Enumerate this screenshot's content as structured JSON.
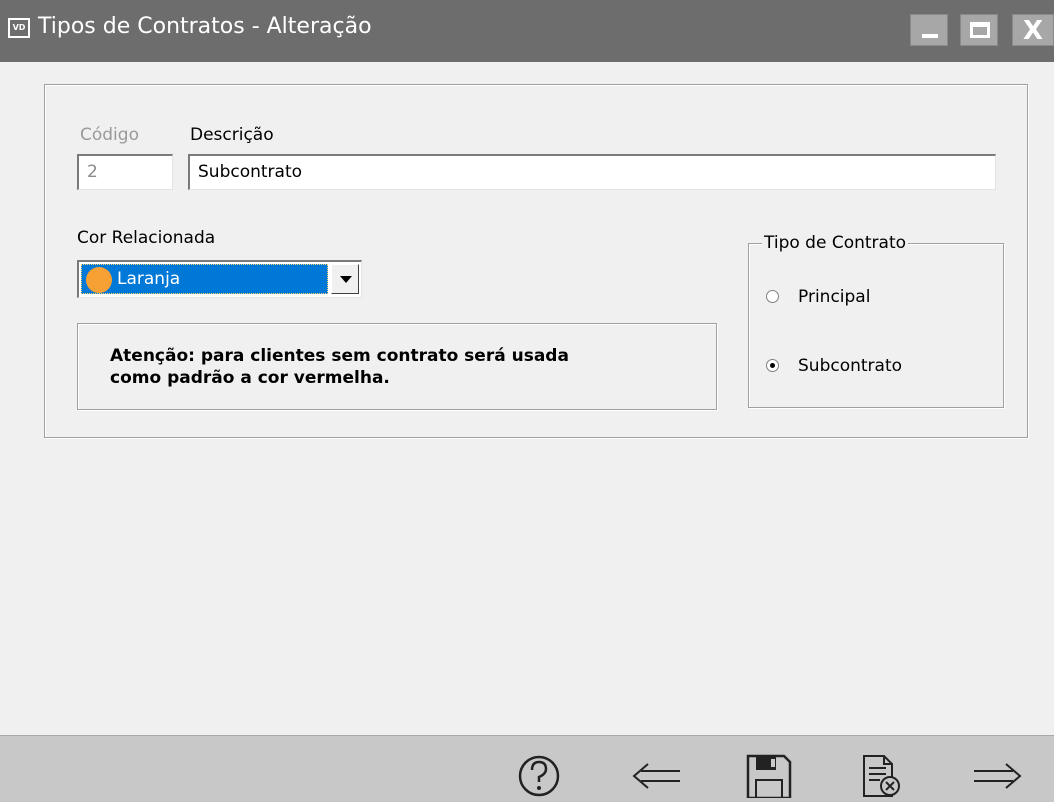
{
  "window": {
    "app_logo": "VD",
    "title": "Tipos de Contratos - Alteração",
    "controls": [
      "minimize-icon",
      "maximize-icon",
      "close-icon"
    ]
  },
  "form": {
    "codigo_label": "Código",
    "codigo_value": "2",
    "descricao_label": "Descrição",
    "descricao_value": "Subcontrato",
    "cor_label": "Cor Relacionada",
    "cor_value": "Laranja",
    "cor_swatch": "#f7a033",
    "notice_line1": "Atenção: para clientes sem contrato será usada",
    "notice_line2": "como padrão a cor vermelha.",
    "tipo_group_label": "Tipo de Contrato",
    "tipo_options": [
      {
        "label": "Principal",
        "checked": false
      },
      {
        "label": "Subcontrato",
        "checked": true
      }
    ]
  },
  "toolbar": {
    "buttons": [
      "help-icon",
      "back-arrow-icon",
      "save-icon",
      "cancel-document-icon",
      "forward-arrow-icon"
    ]
  },
  "colors": {
    "titlebar": "#6d6d6d",
    "selection": "#0078d7",
    "background": "#f0f0f0",
    "toolbar": "#c8c8c8"
  }
}
